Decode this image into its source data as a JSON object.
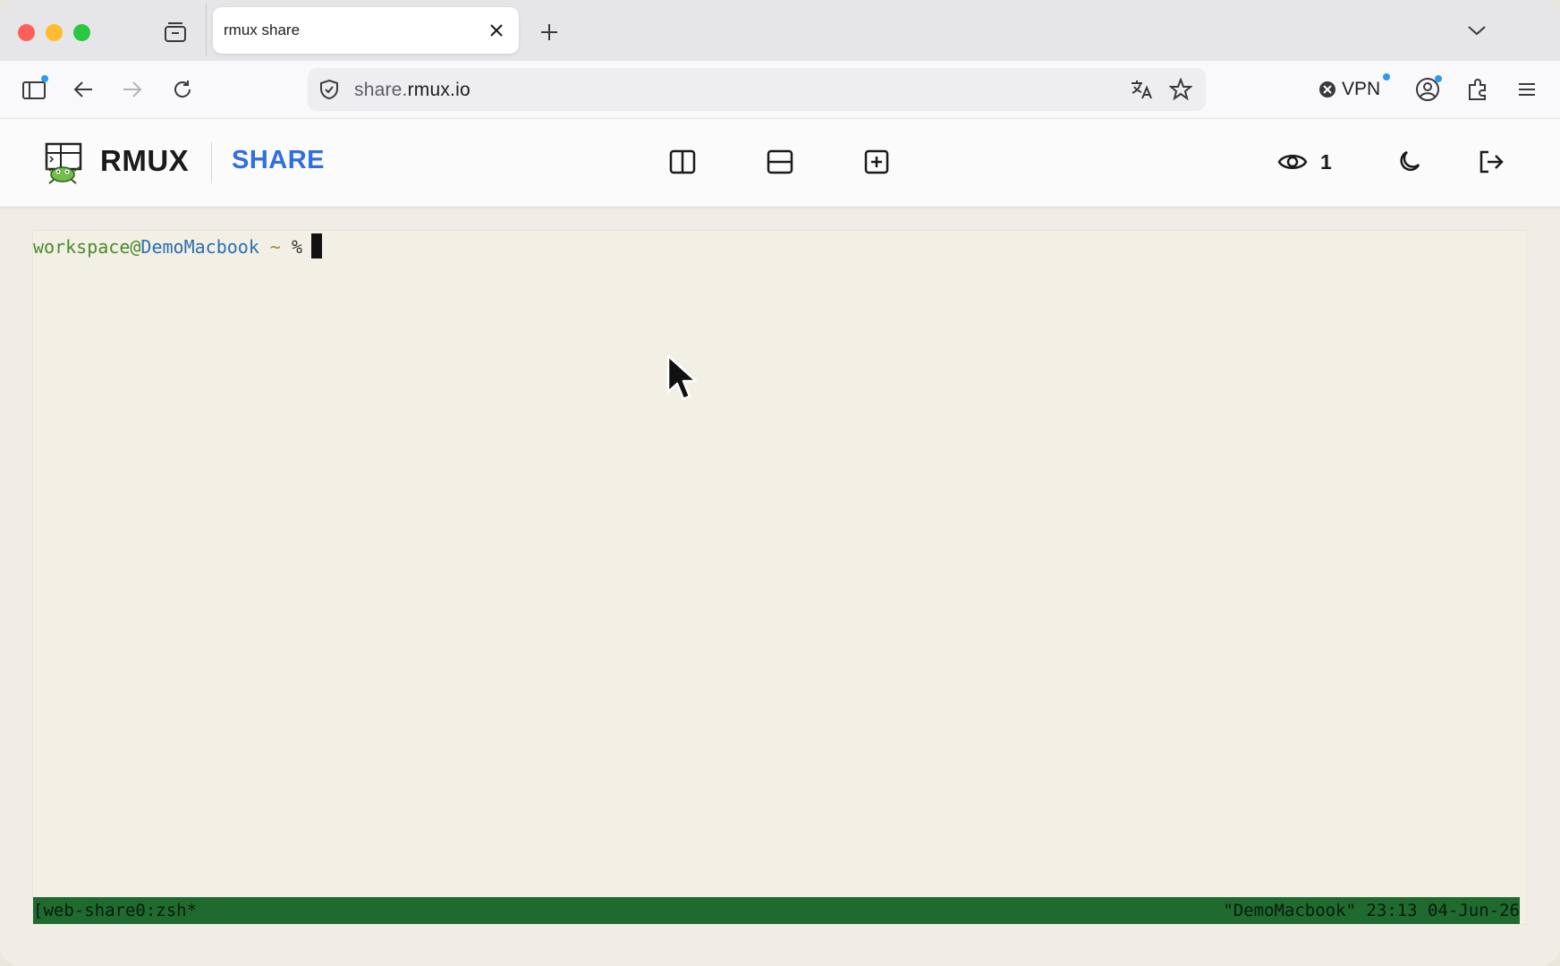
{
  "browser": {
    "tab": {
      "title": "rmux share"
    },
    "url": {
      "scheme_part": "share.",
      "host_part": "rmux.io"
    },
    "vpn_label": "VPN"
  },
  "app": {
    "brand": "RMUX",
    "product": "SHARE",
    "viewer_count": "1",
    "icons": [
      "split-vertical-icon",
      "split-horizontal-icon",
      "new-pane-icon",
      "eye-icon",
      "moon-icon",
      "logout-icon"
    ]
  },
  "terminal": {
    "prompt_user": "workspace",
    "prompt_at": "@",
    "prompt_host": "DemoMacbook",
    "prompt_tilde": " ~",
    "prompt_symbol": " %",
    "status_left": "[web-share0:zsh*",
    "status_right": "\"DemoMacbook\" 23:13 04-Jun-26"
  },
  "colors": {
    "accent": "#2f6fe0",
    "status_bar": "#1f6a2e",
    "terminal_bg": "#f2efe5"
  }
}
